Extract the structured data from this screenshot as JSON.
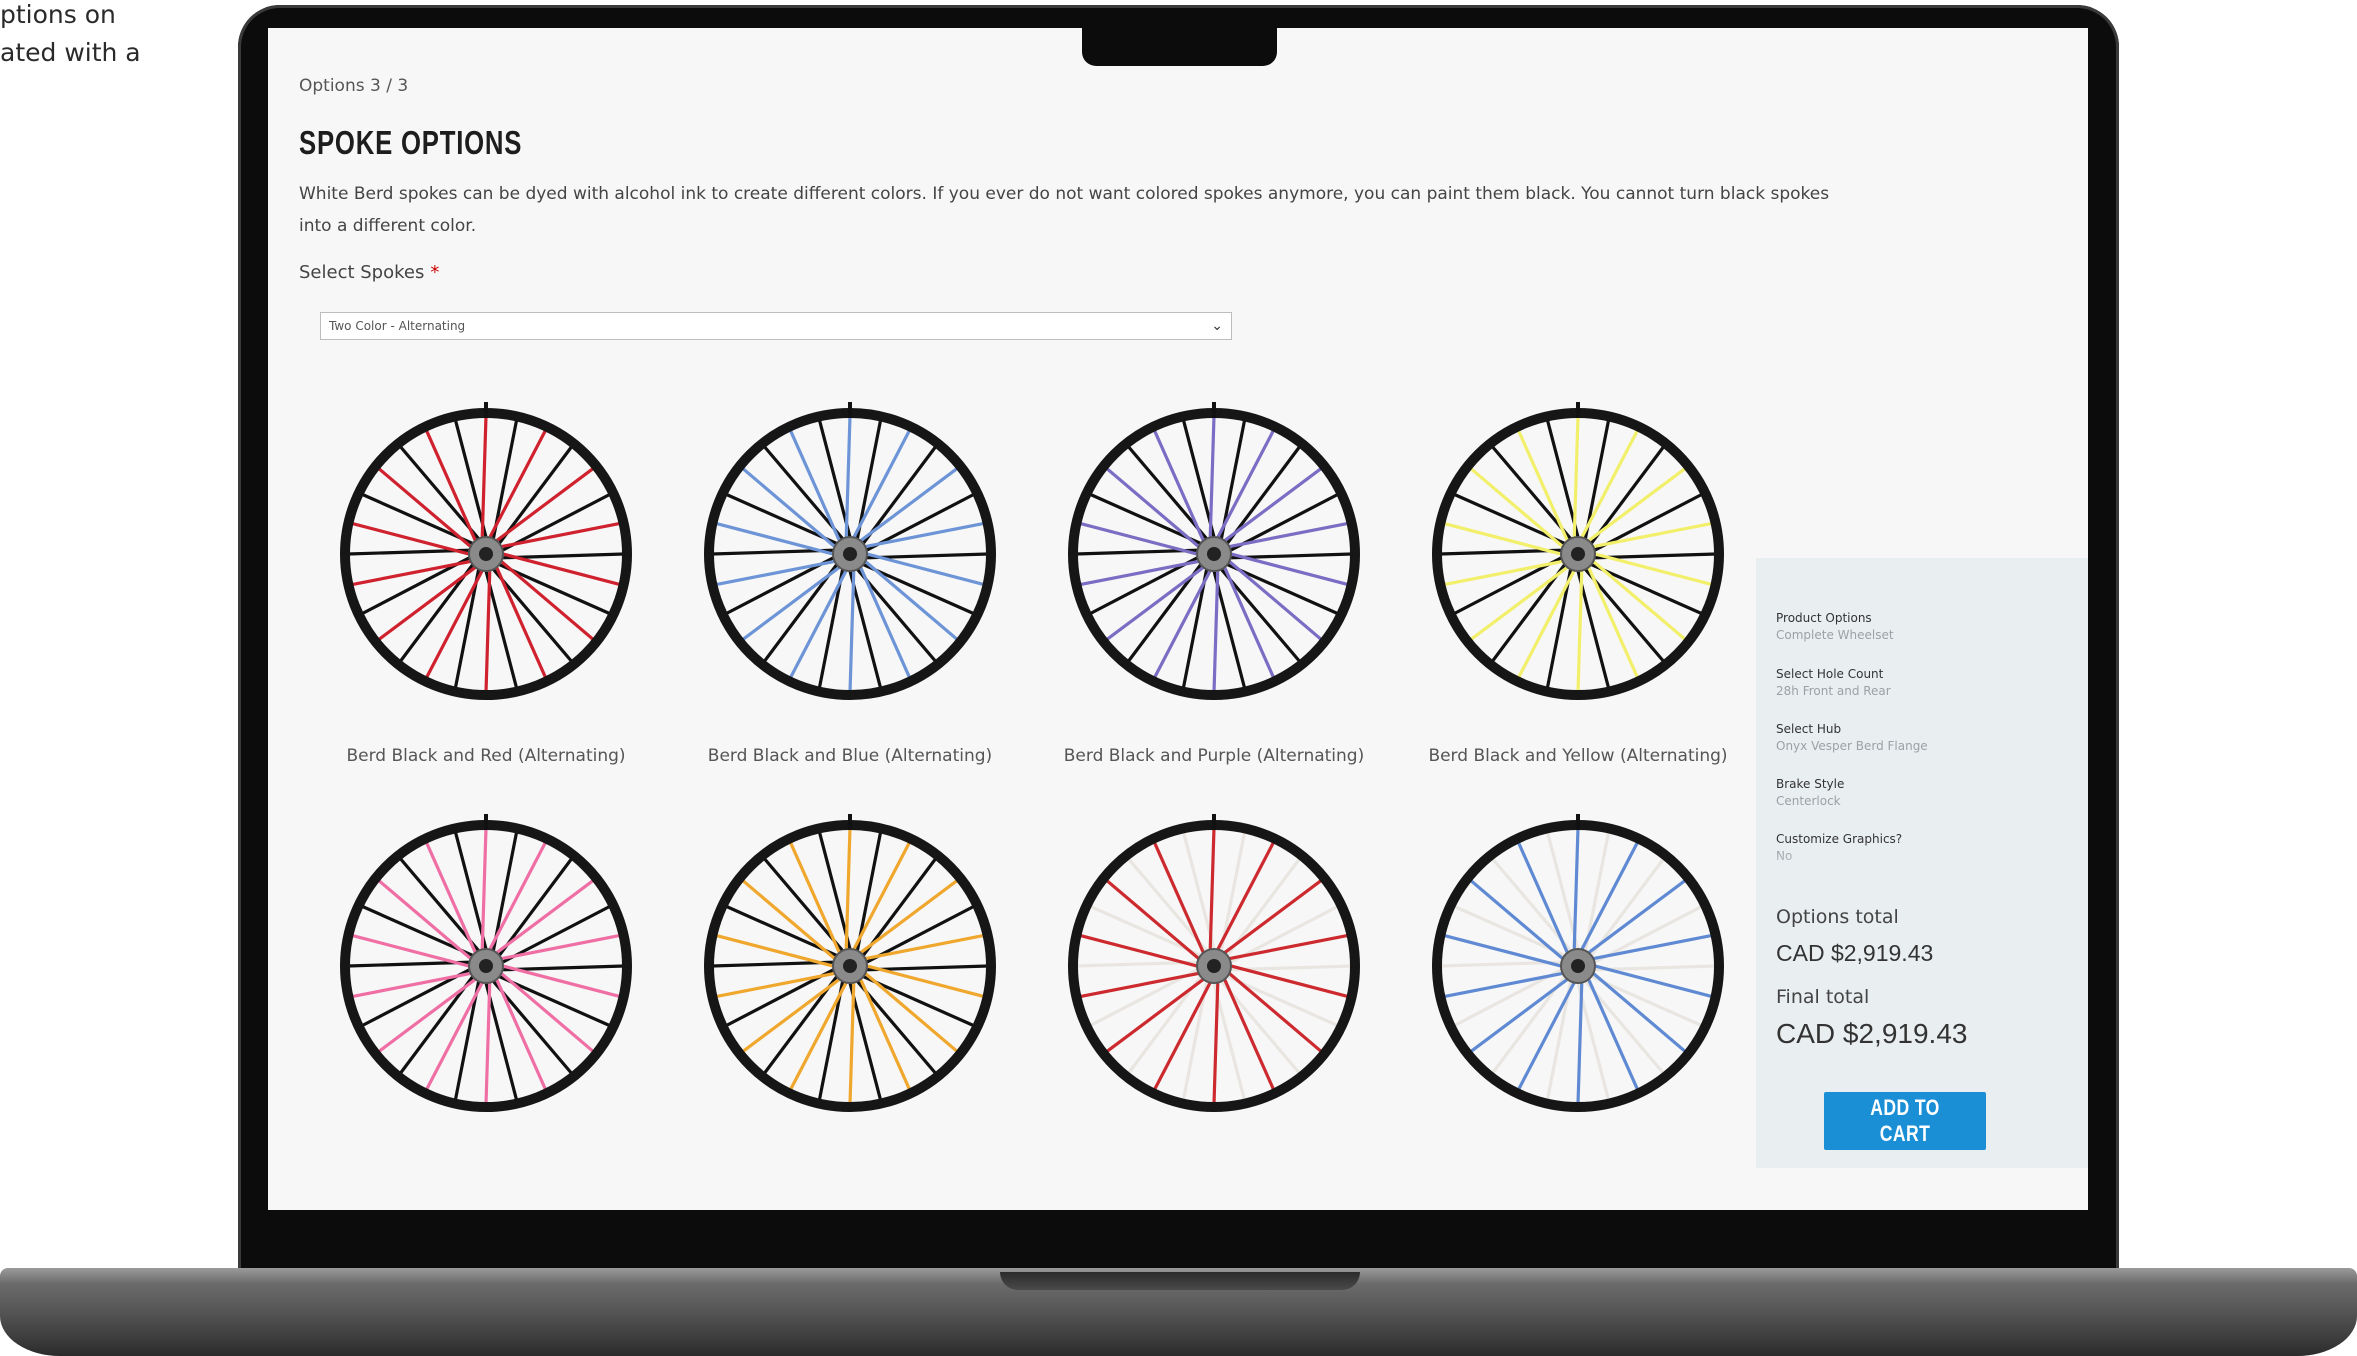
{
  "corner_text": [
    "ptions on",
    "ated with a"
  ],
  "step": "Options 3 / 3",
  "title": "SPOKE OPTIONS",
  "description": "White  Berd spokes can be dyed with alcohol ink to create different colors.  If you ever do not want colored spokes anymore, you can paint them black. You cannot turn black spokes into a different color.",
  "select": {
    "label": "Select Spokes",
    "required_mark": "*",
    "value": "Two Color - Alternating"
  },
  "wheels": [
    {
      "caption": "Berd  Black and  Red (Alternating)",
      "colors": [
        "#111111",
        "#d0212e"
      ]
    },
    {
      "caption": "Berd  Black and  Blue (Alternating)",
      "colors": [
        "#111111",
        "#6d94d6"
      ]
    },
    {
      "caption": "Berd  Black and  Purple (Alternating)",
      "colors": [
        "#111111",
        "#7b6cc4"
      ]
    },
    {
      "caption": "Berd  Black and Yellow (Alternating)",
      "colors": [
        "#111111",
        "#f2ef6a"
      ]
    },
    {
      "caption": "",
      "colors": [
        "#111111",
        "#ef6fa5"
      ]
    },
    {
      "caption": "",
      "colors": [
        "#111111",
        "#f0a72d"
      ]
    },
    {
      "caption": "",
      "colors": [
        "#e9e6e2",
        "#cc2a2f"
      ]
    },
    {
      "caption": "",
      "colors": [
        "#e9e6e2",
        "#5f8ad3"
      ]
    }
  ],
  "summary": {
    "items": [
      {
        "label": "Product Options",
        "value": "Complete Wheelset"
      },
      {
        "label": "Select  Hole Count",
        "value": "28h  Front and  Rear"
      },
      {
        "label": "Select  Hub",
        "value": "Onyx Vesper  Berd  Flange"
      },
      {
        "label": "Brake Style",
        "value": "Centerlock"
      },
      {
        "label": "Customize Graphics?",
        "value": "No"
      }
    ],
    "options_total_label": "Options total",
    "options_total": "CAD $2,919.43",
    "final_total_label": "Final total",
    "final_total": "CAD $2,919.43",
    "add_to_cart": "ADD TO CART"
  }
}
